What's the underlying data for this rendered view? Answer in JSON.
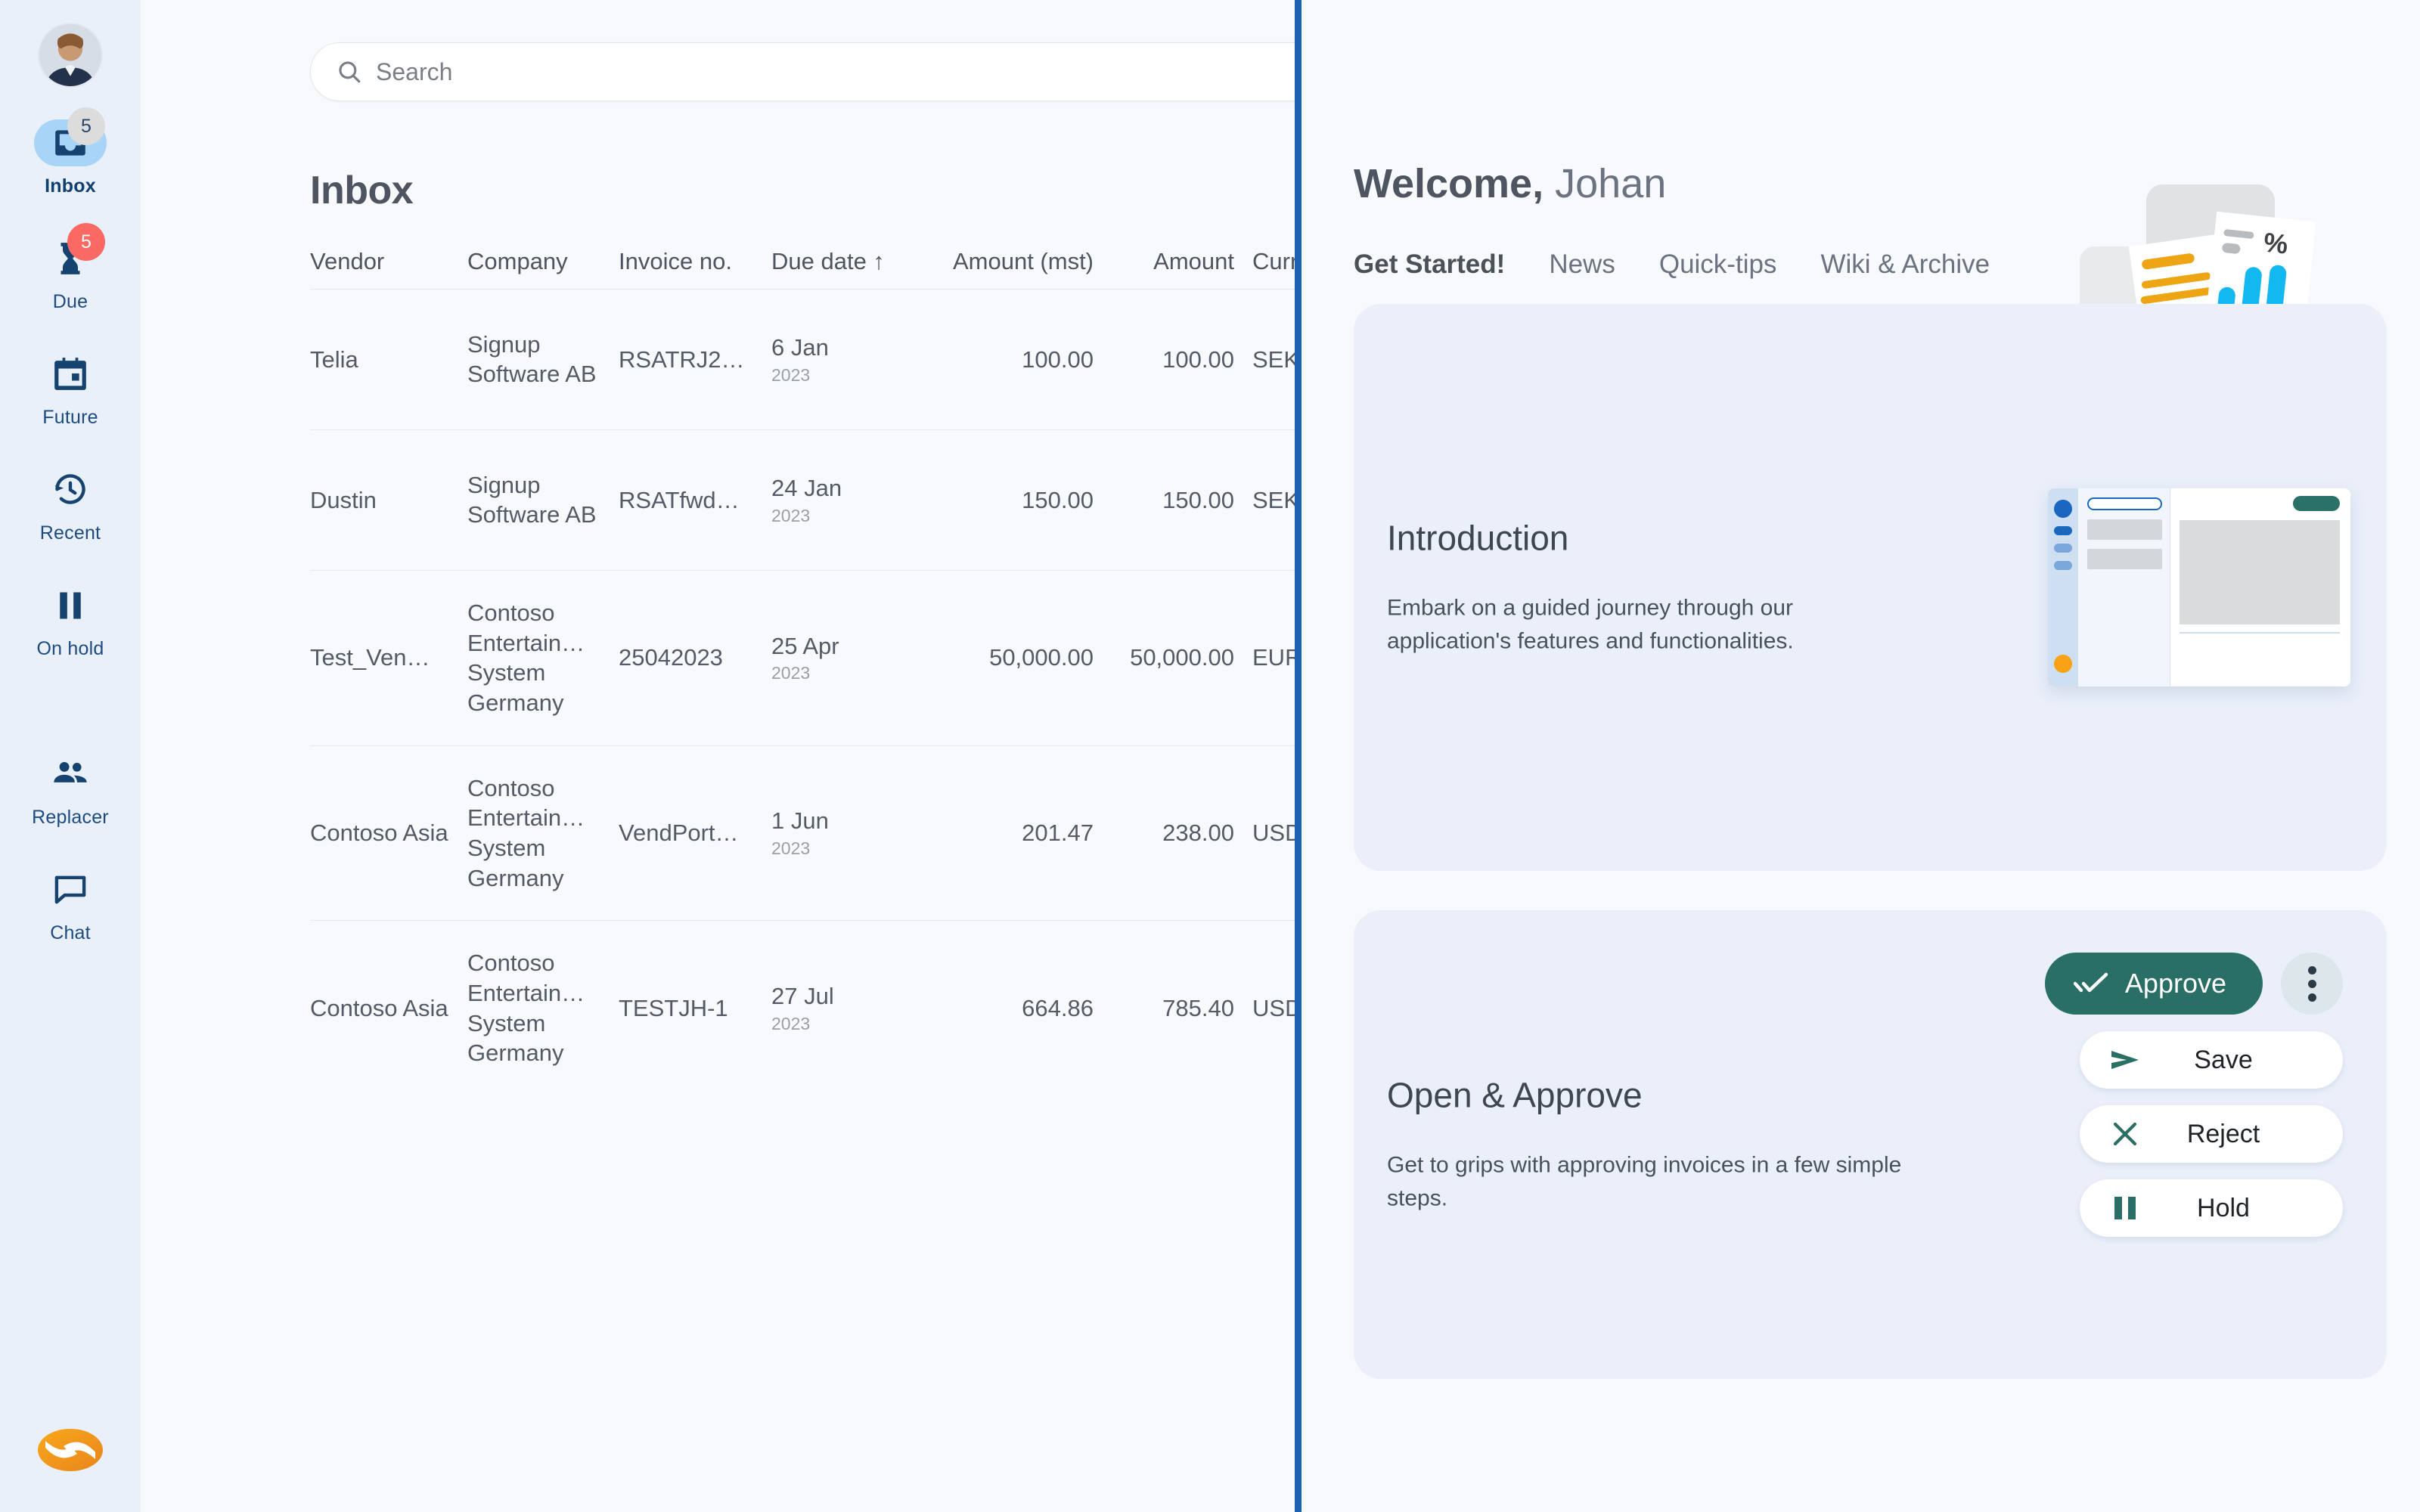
{
  "sidebar": {
    "avatar_name": "user-avatar",
    "items": [
      {
        "label": "Inbox",
        "icon": "inbox-icon",
        "badge": "5",
        "badge_color": "#dcdcdc",
        "active": true
      },
      {
        "label": "Due",
        "icon": "hourglass-icon",
        "badge": "5",
        "badge_color": "#fa6a63",
        "active": false
      },
      {
        "label": "Future",
        "icon": "calendar-icon",
        "badge": "",
        "active": false
      },
      {
        "label": "Recent",
        "icon": "history-clock-icon",
        "badge": "",
        "active": false
      },
      {
        "label": "On hold",
        "icon": "pause-icon",
        "badge": "",
        "active": false
      },
      {
        "label": "Replacer",
        "icon": "people-icon",
        "badge": "",
        "active": false
      },
      {
        "label": "Chat",
        "icon": "chat-bubble-icon",
        "badge": "",
        "active": false
      }
    ],
    "logo": "brand-logo-icon"
  },
  "search": {
    "placeholder": "Search",
    "value": "",
    "icon": "search-icon"
  },
  "inbox": {
    "title": "Inbox",
    "columns": [
      "Vendor",
      "Company",
      "Invoice no.",
      "Due date ↑",
      "Amount (mst)",
      "Amount",
      "Currency"
    ],
    "sort_indicator": "↑",
    "rows": [
      {
        "vendor": "Telia",
        "company": "Signup Software AB",
        "invoice_no": "RSATRJ2…",
        "due_day": "6 Jan",
        "due_year": "2023",
        "amount_mst": "100.00",
        "amount": "100.00",
        "currency": "SEK"
      },
      {
        "vendor": "Dustin",
        "company": "Signup Software AB",
        "invoice_no": "RSATfwd…",
        "due_day": "24 Jan",
        "due_year": "2023",
        "amount_mst": "150.00",
        "amount": "150.00",
        "currency": "SEK"
      },
      {
        "vendor": "Test_Ven…",
        "company": "Contoso Entertain… System Germany",
        "invoice_no": "25042023",
        "due_day": "25 Apr",
        "due_year": "2023",
        "amount_mst": "50,000.00",
        "amount": "50,000.00",
        "currency": "EUR"
      },
      {
        "vendor": "Contoso Asia",
        "company": "Contoso Entertain… System Germany",
        "invoice_no": "VendPort…",
        "due_day": "1 Jun",
        "due_year": "2023",
        "amount_mst": "201.47",
        "amount": "238.00",
        "currency": "USD"
      },
      {
        "vendor": "Contoso Asia",
        "company": "Contoso Entertain… System Germany",
        "invoice_no": "TESTJH-1",
        "due_day": "27 Jul",
        "due_year": "2023",
        "amount_mst": "664.86",
        "amount": "785.40",
        "currency": "USD"
      }
    ]
  },
  "welcome": {
    "greeting": "Welcome,",
    "user": "Johan"
  },
  "tabs": [
    {
      "label": "Get Started!",
      "active": true
    },
    {
      "label": "News",
      "active": false
    },
    {
      "label": "Quick-tips",
      "active": false
    },
    {
      "label": "Wiki & Archive",
      "active": false
    }
  ],
  "cards": [
    {
      "title": "Introduction",
      "text": "Embark on a guided journey through our application's features and functionalities."
    },
    {
      "title": "Open & Approve",
      "text": "Get to grips with approving invoices in a few simple steps."
    }
  ],
  "actions": {
    "approve": {
      "label": "Approve",
      "icon": "double-check-icon"
    },
    "more": {
      "icon": "kebab-menu-icon"
    },
    "buttons": [
      {
        "label": "Save",
        "icon": "send-arrow-icon"
      },
      {
        "label": "Reject",
        "icon": "close-x-icon"
      },
      {
        "label": "Hold",
        "icon": "pause-icon"
      }
    ]
  },
  "colors": {
    "accent_blue": "#1b62b5",
    "sidebar_bg": "#e9f0fa",
    "active_nav": "#a7d4f7",
    "approve_green": "#2a6f66",
    "badge_red": "#fa6a63",
    "card_bg": "#eaeffa",
    "page_bg": "#f7f9fc",
    "brand_orange": "#f3960f"
  }
}
